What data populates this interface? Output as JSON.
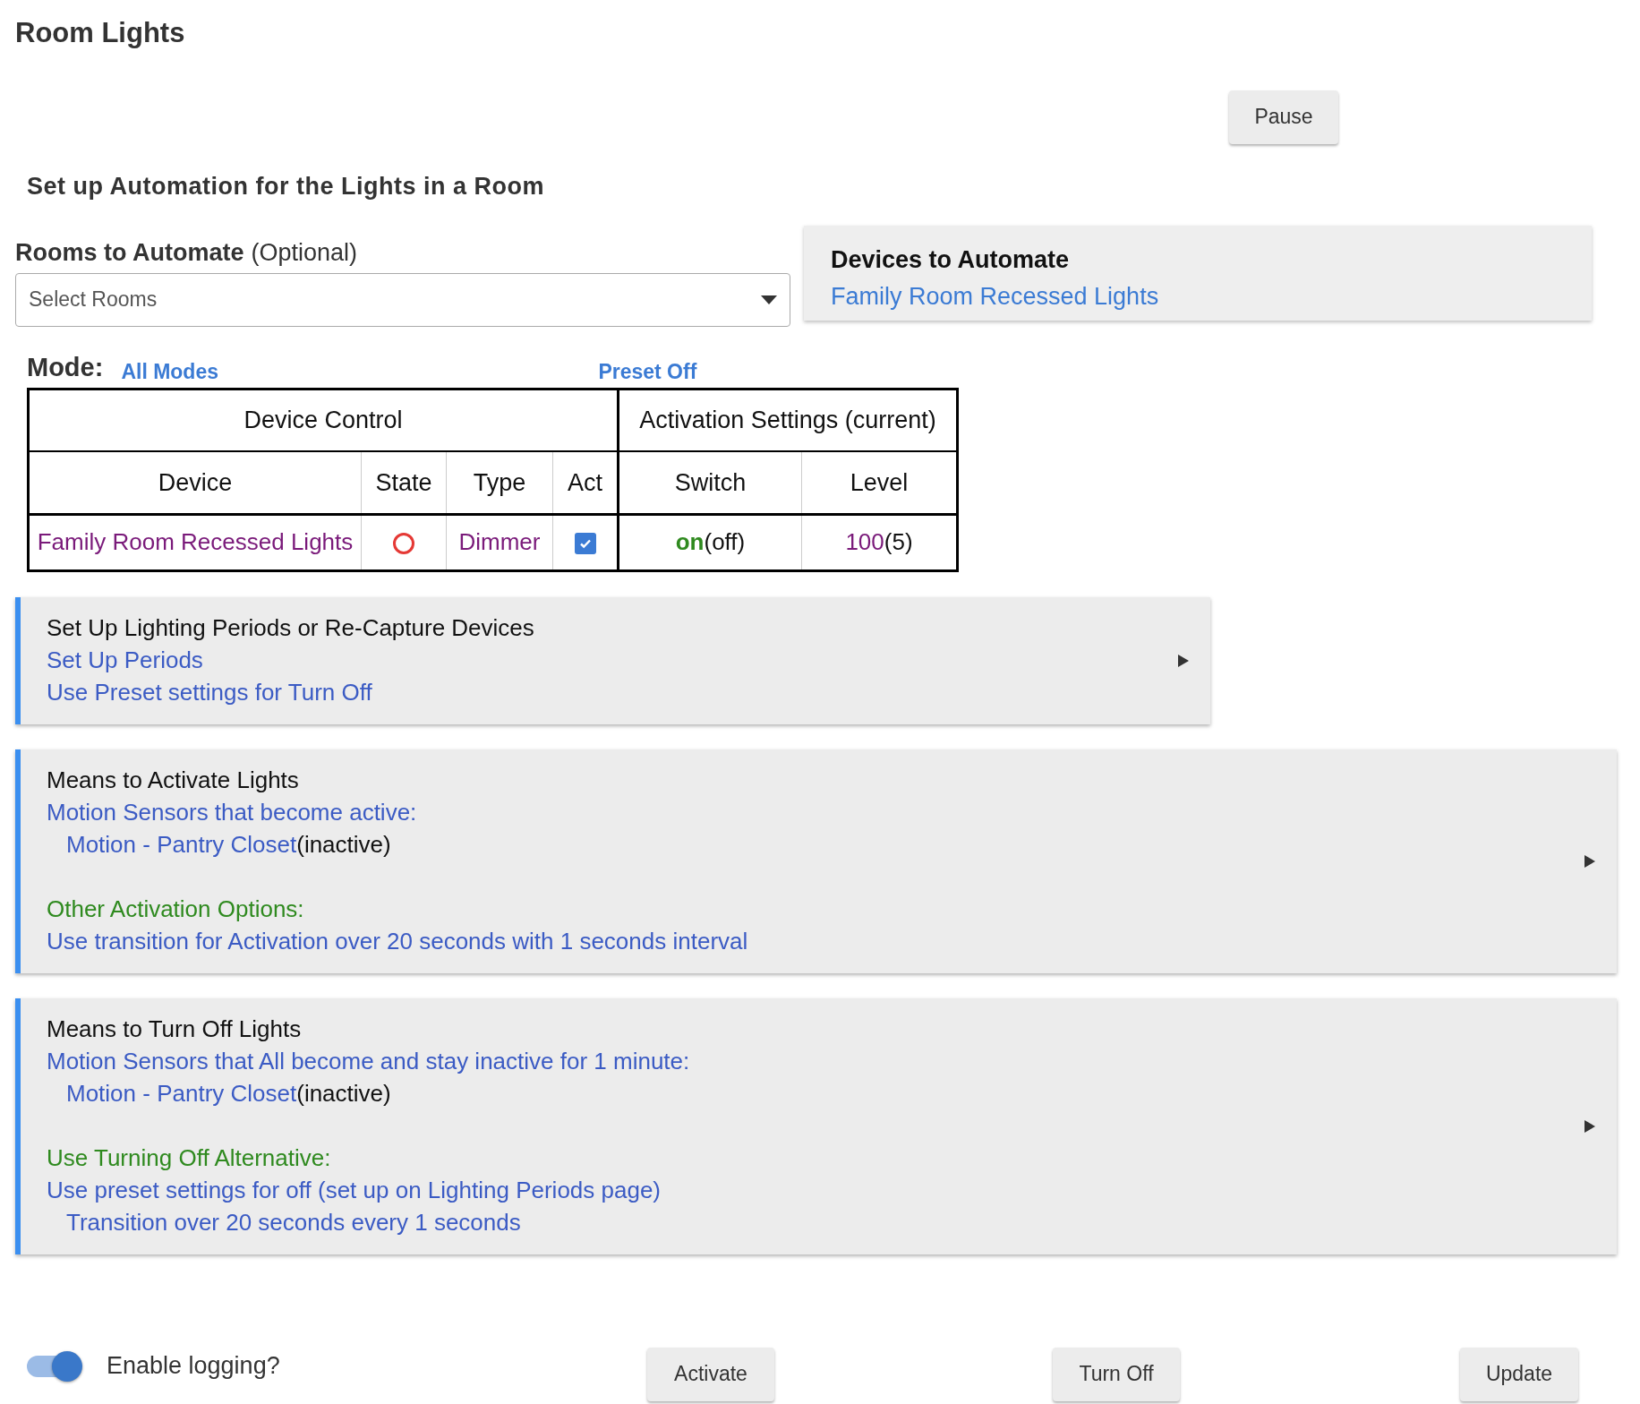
{
  "title": "Room Lights",
  "pause_button": "Pause",
  "heading": "Set up Automation for the Lights in a Room",
  "rooms": {
    "label": "Rooms to Automate",
    "hint": "(Optional)",
    "placeholder": "Select Rooms"
  },
  "devices_card": {
    "title": "Devices to Automate",
    "value": "Family Room Recessed Lights"
  },
  "mode": {
    "label": "Mode:",
    "value": "All Modes",
    "preset": "Preset Off"
  },
  "table": {
    "groups": [
      "Device Control",
      "Activation Settings (current)"
    ],
    "columns": [
      "Device",
      "State",
      "Type",
      "Act",
      "Switch",
      "Level"
    ],
    "rows": [
      {
        "device": "Family Room Recessed Lights",
        "state_on": false,
        "type": "Dimmer",
        "act_checked": true,
        "switch": "on",
        "switch_current": "(off)",
        "level": "100",
        "level_current": "(5)"
      }
    ]
  },
  "sections": [
    {
      "wide": false,
      "lines": [
        {
          "kind": "title",
          "text": "Set Up Lighting Periods or Re-Capture Devices"
        },
        {
          "kind": "link",
          "text": "Set Up Periods"
        },
        {
          "kind": "link",
          "text": "Use Preset settings for Turn Off"
        }
      ]
    },
    {
      "wide": true,
      "lines": [
        {
          "kind": "title",
          "text": "Means to Activate Lights"
        },
        {
          "kind": "link",
          "text": "Motion Sensors that become active:"
        },
        {
          "kind": "sub",
          "text": "Motion - Pantry Closet",
          "suffix": "(inactive)"
        },
        {
          "kind": "option",
          "text": "Other Activation Options:"
        },
        {
          "kind": "link",
          "text": "Use transition for Activation over 20 seconds with 1 seconds interval"
        }
      ]
    },
    {
      "wide": true,
      "lines": [
        {
          "kind": "title",
          "text": "Means to Turn Off Lights"
        },
        {
          "kind": "link",
          "text": "Motion Sensors that All become and stay inactive for 1 minute:"
        },
        {
          "kind": "sub",
          "text": "Motion - Pantry Closet",
          "suffix": "(inactive)"
        },
        {
          "kind": "option",
          "text": "Use Turning Off Alternative:"
        },
        {
          "kind": "link",
          "text": "Use preset settings for off (set up on Lighting Periods page)"
        },
        {
          "kind": "sub",
          "text": "Transition over 20 seconds every 1 seconds"
        }
      ]
    }
  ],
  "logging": {
    "label": "Enable logging?",
    "on": true
  },
  "buttons": [
    "Activate",
    "Turn Off",
    "Update"
  ]
}
